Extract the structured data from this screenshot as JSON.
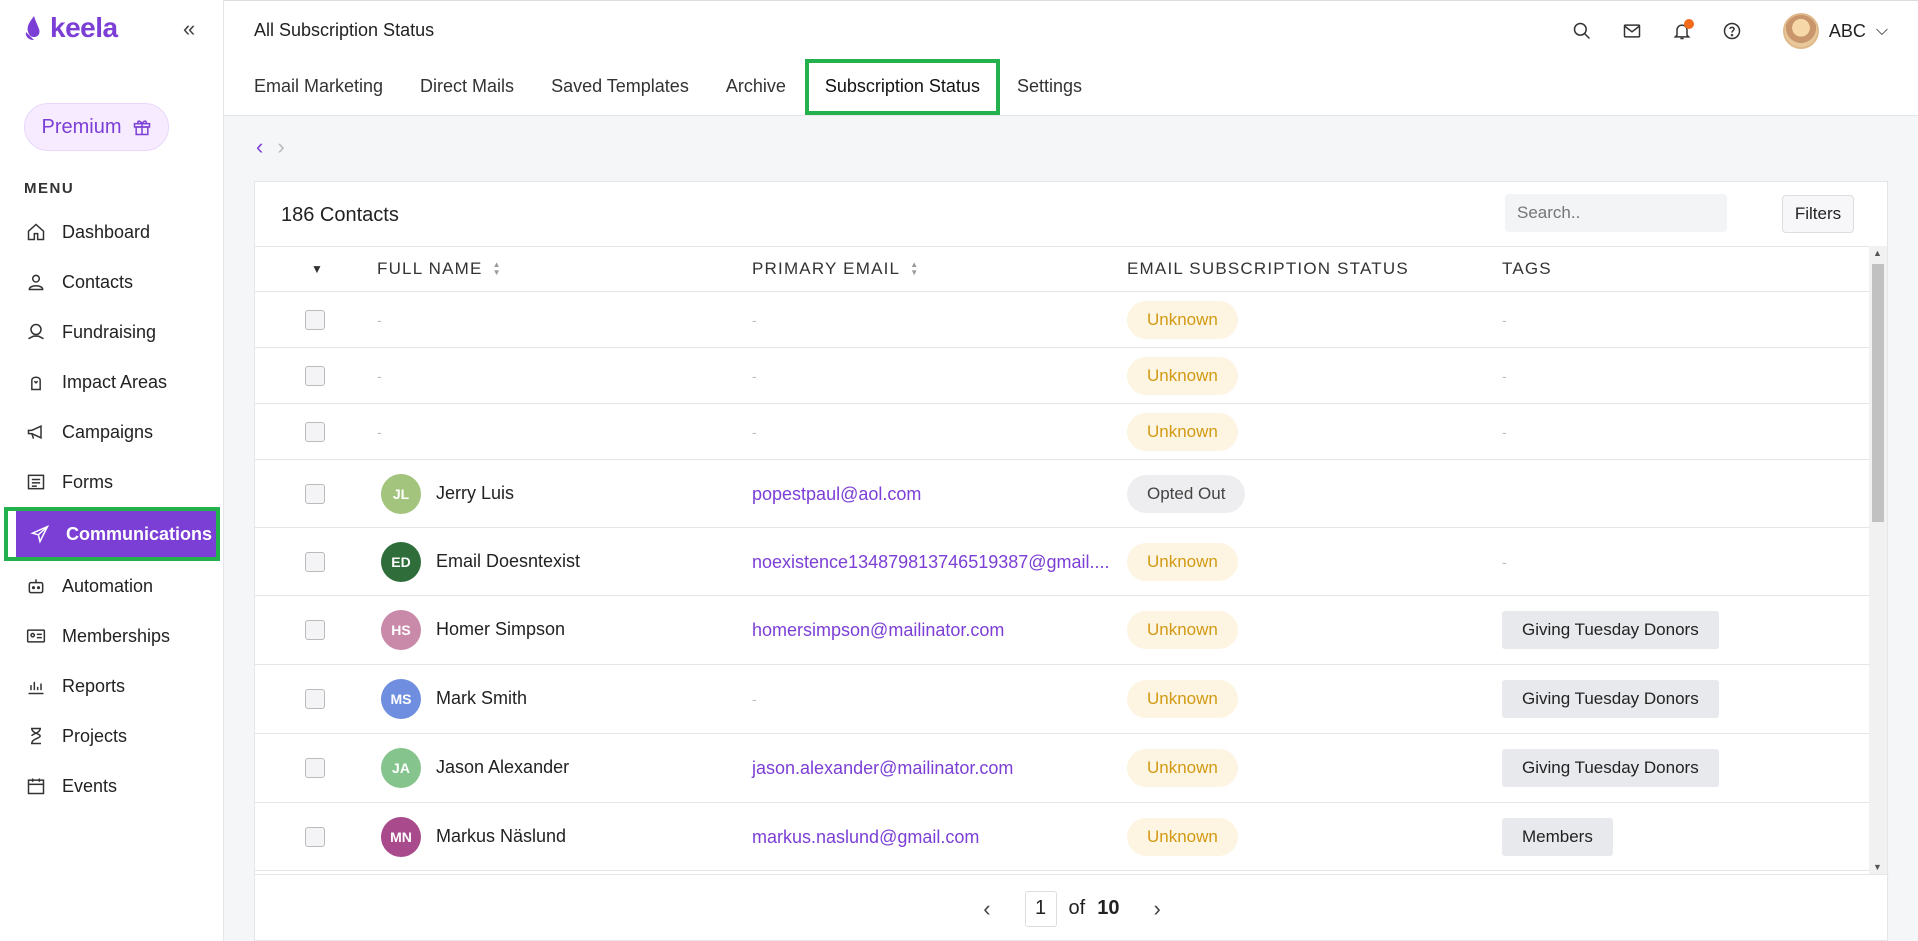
{
  "sidebar": {
    "logo": "keela",
    "premium_label": "Premium",
    "menu_label": "MENU",
    "items": [
      {
        "label": "Dashboard"
      },
      {
        "label": "Contacts"
      },
      {
        "label": "Fundraising"
      },
      {
        "label": "Impact Areas"
      },
      {
        "label": "Campaigns"
      },
      {
        "label": "Forms"
      },
      {
        "label": "Communications"
      },
      {
        "label": "Automation"
      },
      {
        "label": "Memberships"
      },
      {
        "label": "Reports"
      },
      {
        "label": "Projects"
      },
      {
        "label": "Events"
      }
    ]
  },
  "header": {
    "title": "All Subscription Status",
    "user_name": "ABC"
  },
  "tabs": [
    {
      "label": "Email Marketing"
    },
    {
      "label": "Direct Mails"
    },
    {
      "label": "Saved Templates"
    },
    {
      "label": "Archive"
    },
    {
      "label": "Subscription Status"
    },
    {
      "label": "Settings"
    }
  ],
  "panel": {
    "count": "186 Contacts",
    "search_placeholder": "Search..",
    "filters_label": "Filters"
  },
  "table": {
    "columns": [
      "FULL NAME",
      "PRIMARY EMAIL",
      "EMAIL SUBSCRIPTION STATUS",
      "TAGS"
    ],
    "rows": [
      {
        "initials": "",
        "name": "-",
        "email": "-",
        "status": "Unknown",
        "tag": "-"
      },
      {
        "initials": "",
        "name": "-",
        "email": "-",
        "status": "Unknown",
        "tag": "-"
      },
      {
        "initials": "",
        "name": "-",
        "email": "-",
        "status": "Unknown",
        "tag": "-"
      },
      {
        "initials": "JL",
        "avatar_color": "#a3c47c",
        "name": "Jerry Luis",
        "email": "popestpaul@aol.com",
        "status": "Opted Out",
        "tag": ""
      },
      {
        "initials": "ED",
        "avatar_color": "#2f6e3a",
        "name": "Email Doesntexist",
        "email": "noexistence134879813746519387@gmail....",
        "status": "Unknown",
        "tag": "-"
      },
      {
        "initials": "HS",
        "avatar_color": "#c88aa8",
        "name": "Homer Simpson",
        "email": "homersimpson@mailinator.com",
        "status": "Unknown",
        "tag": "Giving Tuesday Donors"
      },
      {
        "initials": "MS",
        "avatar_color": "#6f8ee0",
        "name": "Mark Smith",
        "email": "-",
        "status": "Unknown",
        "tag": "Giving Tuesday Donors"
      },
      {
        "initials": "JA",
        "avatar_color": "#86c48e",
        "name": "Jason Alexander",
        "email": "jason.alexander@mailinator.com",
        "status": "Unknown",
        "tag": "Giving Tuesday Donors"
      },
      {
        "initials": "MN",
        "avatar_color": "#a84a8c",
        "name": "Markus Näslund",
        "email": "markus.naslund@gmail.com",
        "status": "Unknown",
        "tag": "Members"
      }
    ]
  },
  "pagination": {
    "current": "1",
    "of_label": "of",
    "total": "10"
  },
  "colors": {
    "accent": "#7c3fd6",
    "highlight": "#22b14c"
  }
}
